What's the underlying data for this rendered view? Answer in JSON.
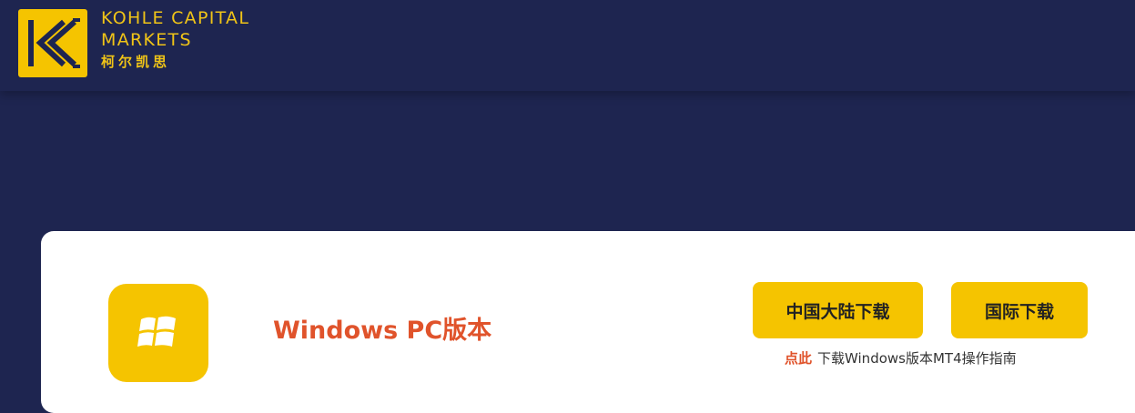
{
  "header": {
    "brand_line1": "KOHLE CAPITAL",
    "brand_line2": "MARKETS",
    "brand_cn": "柯尔凯思",
    "logo_color": "#f5c400",
    "background_color": "#1e2550"
  },
  "download_card": {
    "icon": "windows-icon",
    "title": "Windows PC版本",
    "title_color": "#e0532b",
    "buttons": {
      "mainland": "中国大陆下载",
      "international": "国际下载"
    },
    "guide": {
      "link_text": "点此",
      "text": "下载Windows版本MT4操作指南"
    },
    "accent_color": "#f5c400"
  }
}
